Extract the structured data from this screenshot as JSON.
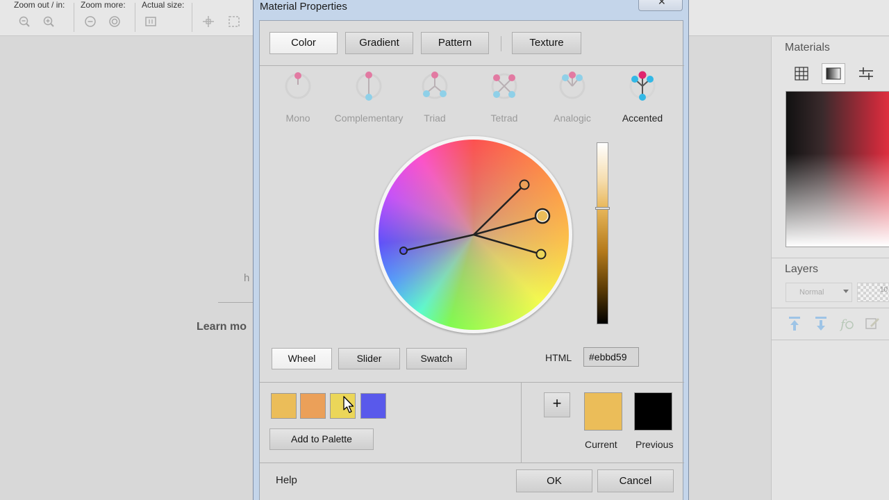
{
  "app": {
    "toolbar": {
      "zoom_out_in_label": "Zoom out / in:",
      "zoom_more_label": "Zoom more:",
      "actual_size_label": "Actual size:"
    },
    "background": {
      "partial_h": "h",
      "learn_more": "Learn mo"
    },
    "materials_panel": {
      "title": "Materials"
    },
    "layers_panel": {
      "title": "Layers",
      "blend_mode": "Normal",
      "opacity_partial": "10"
    }
  },
  "dialog": {
    "title": "Material Properties",
    "close_label": "✕",
    "tabs": [
      {
        "label": "Color",
        "active": true
      },
      {
        "label": "Gradient",
        "active": false
      },
      {
        "label": "Pattern",
        "active": false
      },
      {
        "label": "Texture",
        "active": false
      }
    ],
    "harmonies": [
      {
        "label": "Mono"
      },
      {
        "label": "Complementary"
      },
      {
        "label": "Triad"
      },
      {
        "label": "Tetrad"
      },
      {
        "label": "Analogic"
      },
      {
        "label": "Accented",
        "active": true
      }
    ],
    "view_modes": [
      {
        "label": "Wheel",
        "active": true
      },
      {
        "label": "Slider"
      },
      {
        "label": "Swatch"
      }
    ],
    "html_label": "HTML",
    "html_value": "#ebbd59",
    "palette_swatches": [
      {
        "color": "#ebbd59"
      },
      {
        "color": "#eba059"
      },
      {
        "color": "#ebd659"
      },
      {
        "color": "#5959eb"
      }
    ],
    "add_to_palette_label": "Add to Palette",
    "add_button_label": "+",
    "current": {
      "label": "Current",
      "color": "#ebbd59"
    },
    "previous": {
      "label": "Previous",
      "color": "#000000"
    },
    "help_label": "Help",
    "ok_label": "OK",
    "cancel_label": "Cancel"
  }
}
